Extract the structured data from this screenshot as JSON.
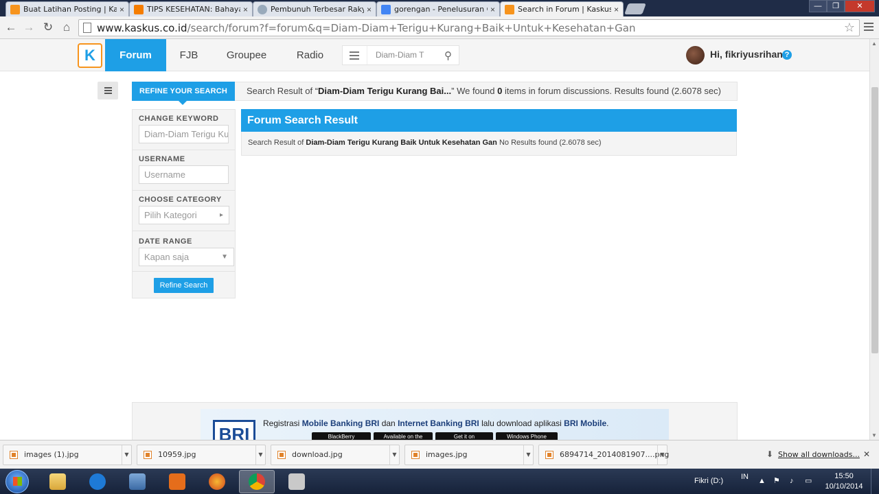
{
  "browser": {
    "tabs": [
      {
        "label": "Buat Latihan Posting | Kas",
        "favicon": "kaskus-favicon",
        "color": "#f7941d"
      },
      {
        "label": "TIPS KESEHATAN: Bahaya",
        "favicon": "blogger-favicon",
        "color": "#f57d00"
      },
      {
        "label": "Pembunuh Terbesar Rakyat",
        "favicon": "loading-favicon",
        "color": "#9ab"
      },
      {
        "label": "gorengan - Penelusuran G",
        "favicon": "google-favicon",
        "color": "#4285f4"
      },
      {
        "label": "Search in Forum | Kaskus",
        "favicon": "kaskus-favicon",
        "color": "#f7941d"
      }
    ],
    "tab_close": "×",
    "url_domain": "www.kaskus.co.id",
    "url_path": "/search/forum?f=forum&q=Diam-Diam+Terigu+Kurang+Baik+Untuk+Kesehatan+Gan",
    "window_buttons": {
      "minimize": "—",
      "maximize": "❐",
      "close": "✕"
    }
  },
  "header": {
    "logo": "K",
    "nav": [
      "Forum",
      "FJB",
      "Groupee",
      "Radio"
    ],
    "search_value": "Diam-Diam T",
    "greeting": "Hi, fikriyusrihan",
    "help": "?"
  },
  "search": {
    "refine_tab": "REFINE YOUR SEARCH",
    "summary_prefix": "Search Result of “",
    "summary_query": "Diam-Diam Terigu Kurang Bai...",
    "summary_mid": "” We found ",
    "summary_count": "0",
    "summary_suffix": " items in forum discussions. Results found (2.6078 sec)"
  },
  "sidebar": {
    "keyword_label": "CHANGE KEYWORD",
    "keyword_value": "Diam-Diam Terigu Ku",
    "username_label": "USERNAME",
    "username_placeholder": "Username",
    "category_label": "CHOOSE CATEGORY",
    "category_value": "Pilih Kategori",
    "date_label": "DATE RANGE",
    "date_value": "Kapan saja",
    "button": "Refine Search"
  },
  "result": {
    "title": "Forum Search Result",
    "prefix": "Search Result of ",
    "query": "Diam-Diam Terigu Kurang Baik Untuk Kesehatan Gan",
    "suffix": " No Results found (2.6078 sec)"
  },
  "ad": {
    "logo": "BRI",
    "text_1": "Registrasi ",
    "bold_1": "Mobile Banking BRI",
    "text_2": " dan ",
    "bold_2": "Internet Banking BRI",
    "text_3": " lalu download aplikasi ",
    "bold_3": "BRI Mobile",
    "text_4": ".",
    "stores": [
      "BlackBerry",
      "Available on the",
      "Get it on",
      "Windows Phone"
    ]
  },
  "downloads": {
    "items": [
      "images (1).jpg",
      "10959.jpg",
      "download.jpg",
      "images.jpg",
      "6894714_2014081907....png"
    ],
    "show_all": "Show all downloads..."
  },
  "taskbar": {
    "drive": "Fikri (D:)",
    "lang": "IN",
    "time": "15:50",
    "date": "10/10/2014"
  }
}
